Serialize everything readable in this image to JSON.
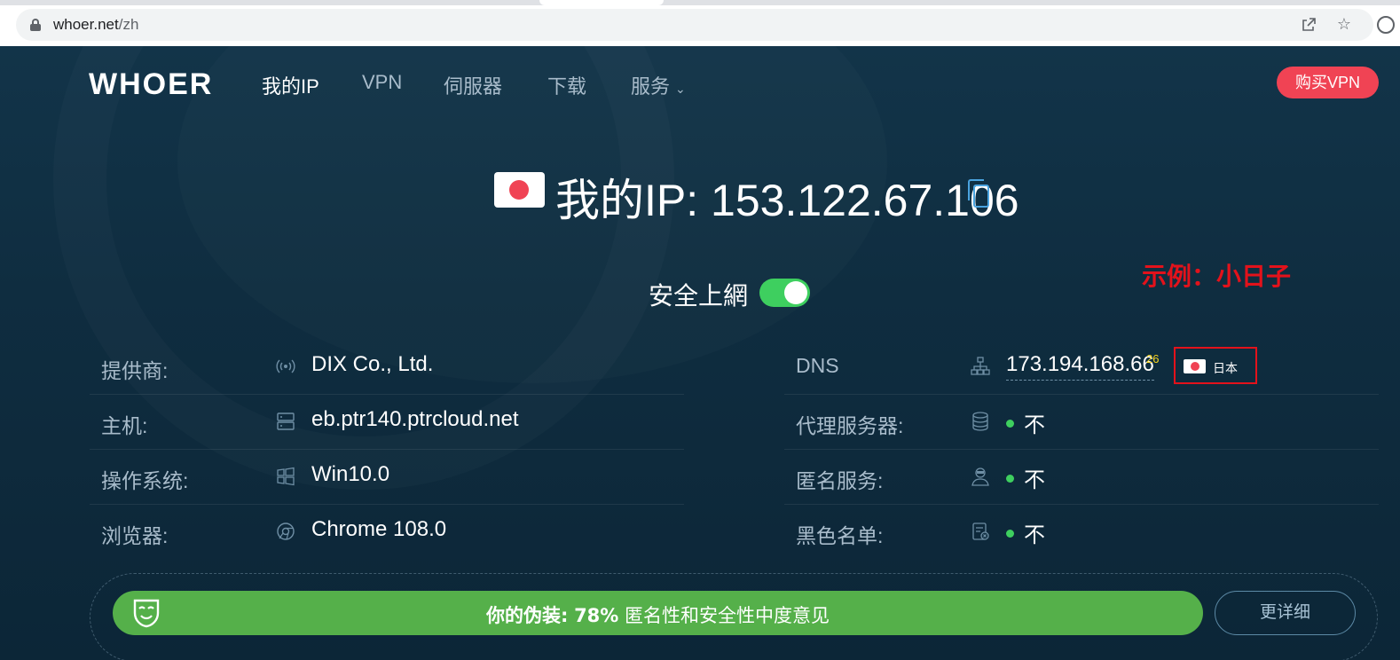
{
  "browser": {
    "url_domain": "whoer.net",
    "url_path": "/zh",
    "share_icon": "share-icon",
    "bookmark_icon": "star-icon"
  },
  "nav": {
    "logo": "WHOER",
    "items": [
      {
        "label": "我的IP",
        "active": true
      },
      {
        "label": "VPN"
      },
      {
        "label": "伺服器"
      },
      {
        "label": "下载"
      },
      {
        "label": "服务"
      }
    ],
    "buy_label": "购买VPN"
  },
  "header": {
    "ip_prefix": "我的IP:",
    "ip": "153.122.67.106",
    "secure_label": "安全上網",
    "secure_on": true
  },
  "annotation": "示例：小日子",
  "left_rows": [
    {
      "label": "提供商:",
      "icon": "broadcast-icon",
      "value": "DIX Co., Ltd."
    },
    {
      "label": "主机:",
      "icon": "server-icon",
      "value": "eb.ptr140.ptrcloud.net"
    },
    {
      "label": "操作系统:",
      "icon": "windows-icon",
      "value": "Win10.0"
    },
    {
      "label": "浏览器:",
      "icon": "chrome-icon",
      "value": "Chrome 108.0"
    }
  ],
  "right_rows": [
    {
      "label": "DNS",
      "icon": "network-icon",
      "value": "173.194.168.66",
      "sup": "26",
      "country": "日本"
    },
    {
      "label": "代理服务器:",
      "icon": "database-icon",
      "value": "不"
    },
    {
      "label": "匿名服务:",
      "icon": "agent-icon",
      "value": "不"
    },
    {
      "label": "黑色名单:",
      "icon": "blacklist-icon",
      "value": "不"
    }
  ],
  "disguise": {
    "prefix": "你的伪装:",
    "percent": "78%",
    "text": "匿名性和安全性中度意见",
    "details_label": "更详细"
  },
  "colors": {
    "accent_red": "#f04354",
    "green": "#55b04a",
    "annotation_red": "#e3121b"
  }
}
